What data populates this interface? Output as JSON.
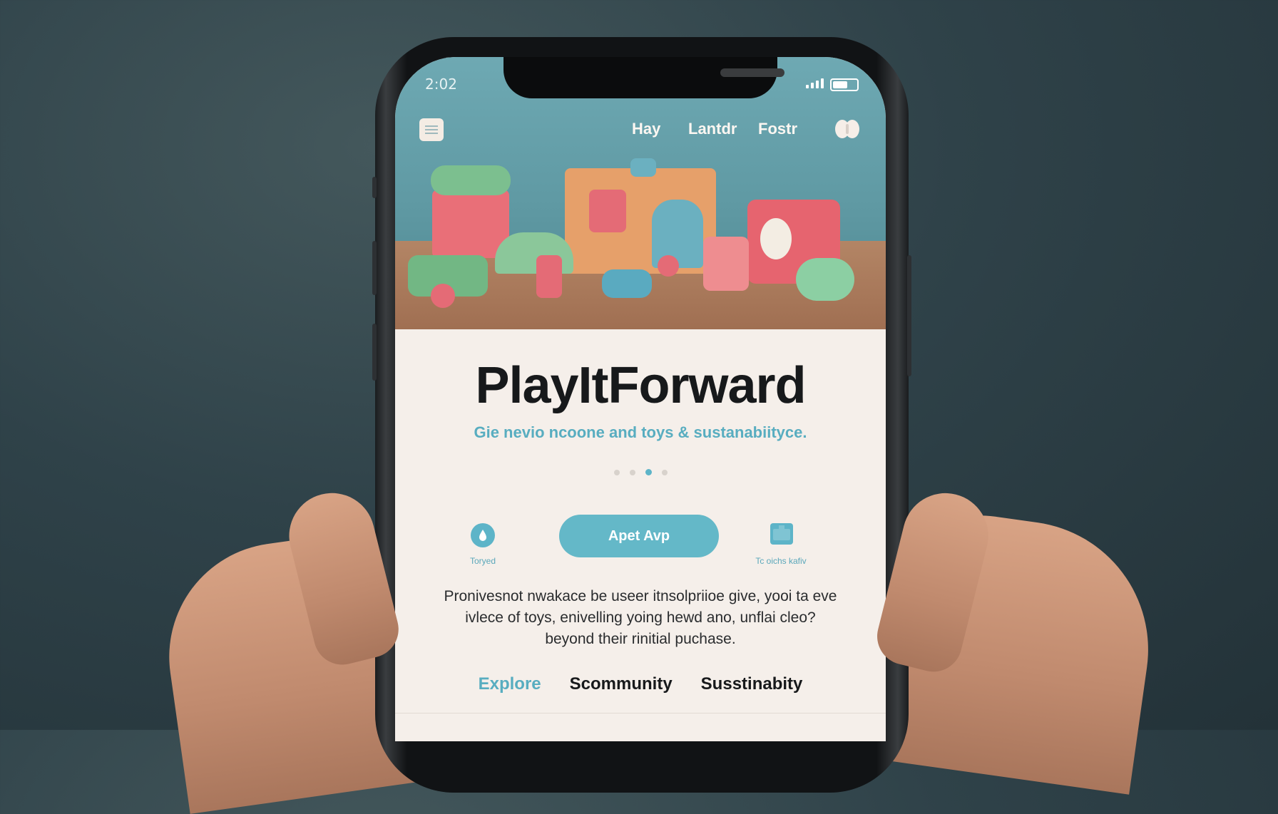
{
  "status_bar": {
    "time": "2:02"
  },
  "nav": {
    "links": [
      "Hay",
      "Lantdr",
      "Fostr"
    ],
    "menu_icon": "menu-icon",
    "profile_icon": "butterfly-icon"
  },
  "hero": {
    "image": "toy-illustration"
  },
  "brand": {
    "title": "PlayItForward",
    "tagline": "Gie nevio ncoone and toys & sustanabiityce."
  },
  "carousel": {
    "dot_count": 4,
    "active_index": 2
  },
  "actions": {
    "left_label": "Toryed",
    "left_icon": "drop-icon",
    "cta_label": "Apet Avp",
    "right_label": "Tc oichs kafiv",
    "right_icon": "box-icon"
  },
  "description": {
    "line1": "Pronivesnot nwakace be useer itnsolpriioe give, yooi ta eve",
    "line2": "ivlece of toys, enivelling yoing hewd ano, unflai cleo?",
    "line3": "beyond their rinitial puchase."
  },
  "bottom_nav": {
    "items": [
      "Explore",
      "Scommunity",
      "Susstinabity"
    ],
    "active_index": 0
  },
  "colors": {
    "accent": "#5db4c8",
    "hero_bg": "#6ea9b3",
    "title": "#17191b",
    "page_bg": "#f5efea"
  }
}
